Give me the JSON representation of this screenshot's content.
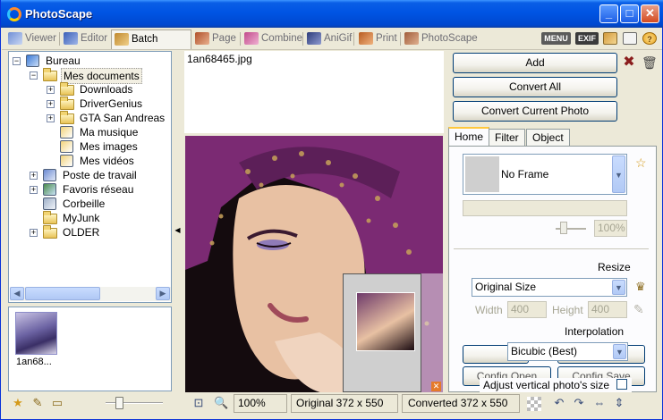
{
  "window": {
    "title": "PhotoScape",
    "minimize": "_",
    "maximize": "□",
    "close": "✕"
  },
  "menu_tabs": [
    {
      "label": "Viewer",
      "icon": "viewer-icon"
    },
    {
      "label": "Editor",
      "icon": "editor-icon"
    },
    {
      "label": "Batch Editor",
      "icon": "batch-editor-icon",
      "active": true
    },
    {
      "label": "Page",
      "icon": "page-icon"
    },
    {
      "label": "Combine",
      "icon": "combine-icon"
    },
    {
      "label": "AniGif",
      "icon": "anigif-icon"
    },
    {
      "label": "Print",
      "icon": "print-icon"
    },
    {
      "label": "PhotoScape",
      "icon": "photoscape-icon"
    }
  ],
  "top_right": {
    "menu_label": "MENU",
    "exif_label": "EXIF"
  },
  "tree": {
    "items": [
      {
        "label": "Bureau",
        "level": 0,
        "expander": "−"
      },
      {
        "label": "Mes documents",
        "level": 1,
        "expander": "−",
        "selected": true
      },
      {
        "label": "Downloads",
        "level": 2,
        "expander": "+"
      },
      {
        "label": "DriverGenius",
        "level": 2,
        "expander": "+"
      },
      {
        "label": "GTA San Andreas",
        "level": 2,
        "expander": "+"
      },
      {
        "label": "Ma musique",
        "level": 2,
        "expander": ""
      },
      {
        "label": "Mes images",
        "level": 2,
        "expander": ""
      },
      {
        "label": "Mes vidéos",
        "level": 2,
        "expander": ""
      },
      {
        "label": "Poste de travail",
        "level": 1,
        "expander": "+"
      },
      {
        "label": "Favoris réseau",
        "level": 1,
        "expander": "+"
      },
      {
        "label": "Corbeille",
        "level": 1,
        "expander": ""
      },
      {
        "label": "MyJunk",
        "level": 1,
        "expander": ""
      },
      {
        "label": "OLDER",
        "level": 1,
        "expander": "+"
      }
    ]
  },
  "thumbnails": [
    {
      "label": "1an68..."
    }
  ],
  "file_list": {
    "filename": "1an68465.jpg"
  },
  "actions": {
    "add": "Add",
    "convert_all": "Convert All",
    "convert_current": "Convert Current Photo"
  },
  "settings_tabs": [
    "Home",
    "Filter",
    "Object"
  ],
  "home": {
    "frame_value": "No Frame",
    "frame_size": "100%",
    "resize_label": "Resize",
    "resize_value": "Original Size",
    "width_label": "Width",
    "width_value": "400",
    "height_label": "Height",
    "height_value": "400",
    "interpolation_label": "Interpolation",
    "interpolation_value": "Bicubic (Best)",
    "config_open": "Config Open",
    "config_save": "Config Save",
    "adjust_label": "Adjust vertical photo's size"
  },
  "status": {
    "zoom": "100%",
    "original": "Original 372 x 550",
    "converted": "Converted 372 x 550"
  },
  "colors": {
    "title_blue": "#0054e3",
    "photo_purple": "#7b2a73",
    "photo_gold": "#c8a25a"
  }
}
